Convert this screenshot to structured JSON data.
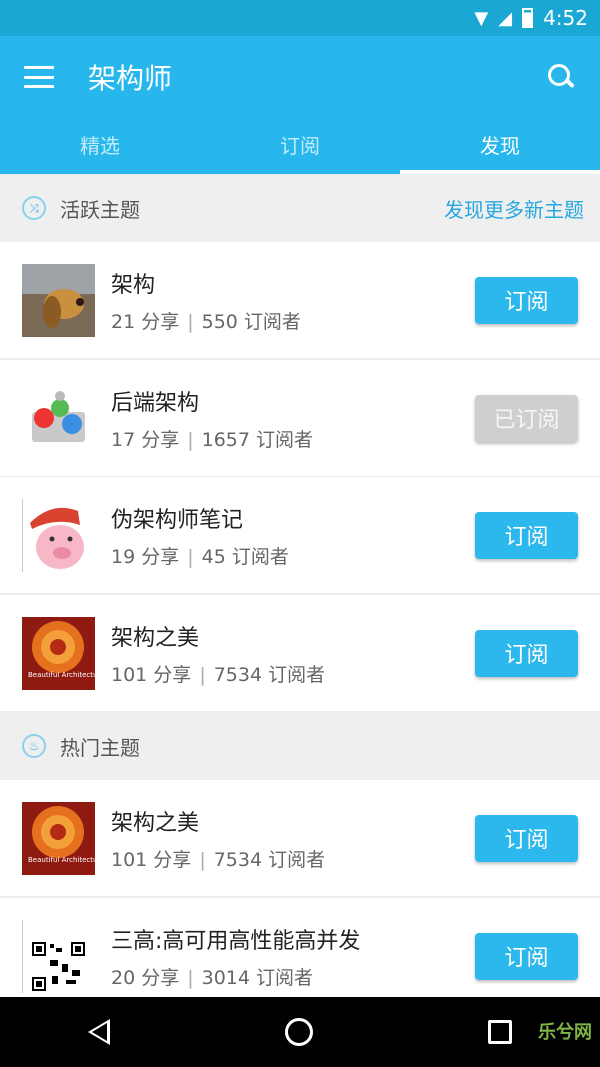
{
  "status": {
    "time": "4:52"
  },
  "app": {
    "title": "架构师"
  },
  "tabs": [
    {
      "label": "精选"
    },
    {
      "label": "订阅"
    },
    {
      "label": "发现"
    }
  ],
  "active_section": {
    "title": "活跃主题",
    "link": "发现更多新主题"
  },
  "hot_section": {
    "title": "热门主题"
  },
  "active_topics": [
    {
      "name": "架构",
      "shares": "21 分享",
      "subs": "550 订阅者",
      "button": "订阅"
    },
    {
      "name": "后端架构",
      "shares": "17 分享",
      "subs": "1657 订阅者",
      "button": "已订阅"
    },
    {
      "name": "伪架构师笔记",
      "shares": "19 分享",
      "subs": "45 订阅者",
      "button": "订阅"
    },
    {
      "name": "架构之美",
      "shares": "101 分享",
      "subs": "7534 订阅者",
      "button": "订阅"
    }
  ],
  "hot_topics": [
    {
      "name": "架构之美",
      "shares": "101 分享",
      "subs": "7534 订阅者",
      "button": "订阅"
    },
    {
      "name": "三高:高可用高性能高并发",
      "shares": "20 分享",
      "subs": "3014 订阅者",
      "button": "订阅"
    }
  ],
  "thumb_text": {
    "beautiful": "Beautiful Architecture"
  },
  "watermark": "乐兮网"
}
